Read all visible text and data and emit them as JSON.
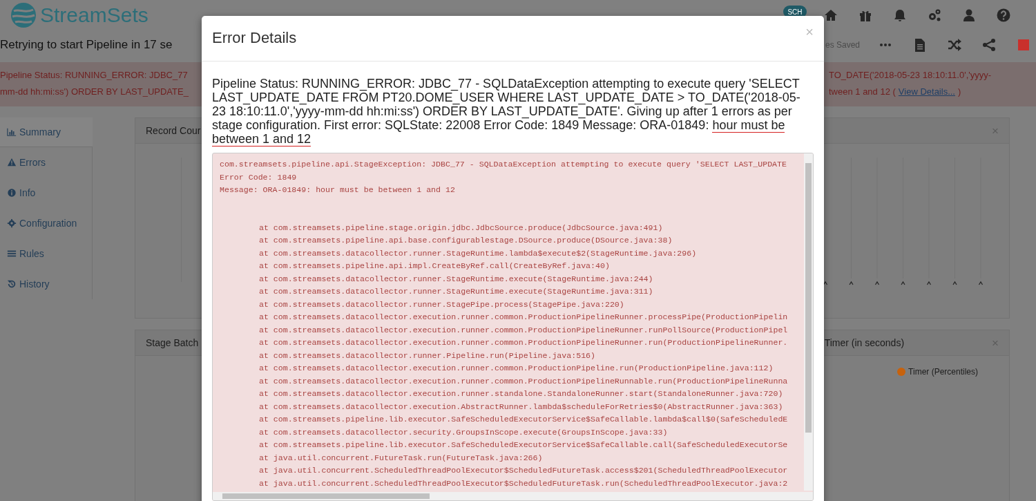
{
  "app": {
    "logo_text": "StreamSets",
    "header_icons": [
      {
        "kind": "cloud",
        "label": "SCH"
      },
      {
        "kind": "home"
      },
      {
        "kind": "gift"
      },
      {
        "kind": "bell"
      },
      {
        "kind": "gears"
      },
      {
        "kind": "user"
      },
      {
        "kind": "help"
      }
    ]
  },
  "status_title": "Retrying to start Pipeline in  17 se",
  "toolbar": {
    "saved_text": "es Saved",
    "buttons": [
      {
        "kind": "more"
      },
      {
        "kind": "document"
      },
      {
        "kind": "shuffle"
      },
      {
        "kind": "share"
      },
      {
        "kind": "stop"
      }
    ]
  },
  "alert": {
    "left_lines": [
      "Pipeline Status: RUNNING_ERROR: JDBC_77",
      "mm-dd hh:mi:ss') ORDER BY LAST_UPDATE_"
    ],
    "right_line": "TO_DATE('2018-05-23 18:10:11.0','yyyy-",
    "right_line_2": {
      "before": "tween 1 and 12 (",
      "link": "View Details...",
      "after": ")"
    }
  },
  "sidebar": {
    "items": [
      {
        "label": "Summary",
        "kind": "chart",
        "selected": true
      },
      {
        "label": "Errors",
        "kind": "warning",
        "selected": false
      },
      {
        "label": "Info",
        "kind": "info",
        "selected": false
      },
      {
        "label": "Configuration",
        "kind": "gear",
        "selected": false
      },
      {
        "label": "Rules",
        "kind": "list",
        "selected": false
      },
      {
        "label": "History",
        "kind": "history",
        "selected": false
      }
    ]
  },
  "panels": [
    {
      "kind": "gridlines",
      "title_left": "Record Cour",
      "close": "×"
    },
    {
      "kind": "legend",
      "title_left": "Stage Batch",
      "title_right": "Timer (in seconds)",
      "close": "×",
      "legend": "Timer (Percentiles)"
    }
  ],
  "modal": {
    "title": "Error Details",
    "close": "×",
    "message": [
      {
        "text": "Pipeline Status: RUNNING_ERROR: JDBC_77 - SQLDataException attempting to execute query 'SELECT LAST_UPDATE_DATE FROM PT20.DOME_USER WHERE LAST_UPDATE_DATE > TO_DATE('2018-05-23 18:10:11.0','yyyy-mm-dd hh:mi:ss') ORDER BY LAST_UPDATE_DATE'. Giving up after 1 errors as per stage configuration. First error: SQLState: 22008 Error Code: 1849 Message: ORA-01849: ",
        "marked": false
      },
      {
        "text": "hour must be between 1 and 12",
        "marked": true
      }
    ],
    "trace": [
      {
        "kind": "head",
        "text": "com.streamsets.pipeline.api.StageException: JDBC_77 - SQLDataException attempting to execute query 'SELECT LAST_UPDATE"
      },
      {
        "kind": "head",
        "text": "Error Code: 1849"
      },
      {
        "kind": "head",
        "text": "Message: ORA-01849: hour must be between 1 and 12"
      },
      {
        "kind": "frame",
        "text": "at com.streamsets.pipeline.stage.origin.jdbc.JdbcSource.produce(JdbcSource.java:491)"
      },
      {
        "kind": "frame",
        "text": "at com.streamsets.pipeline.api.base.configurablestage.DSource.produce(DSource.java:38)"
      },
      {
        "kind": "frame",
        "text": "at com.streamsets.datacollector.runner.StageRuntime.lambda$execute$2(StageRuntime.java:296)"
      },
      {
        "kind": "frame",
        "text": "at com.streamsets.pipeline.api.impl.CreateByRef.call(CreateByRef.java:40)"
      },
      {
        "kind": "frame",
        "text": "at com.streamsets.datacollector.runner.StageRuntime.execute(StageRuntime.java:244)"
      },
      {
        "kind": "frame",
        "text": "at com.streamsets.datacollector.runner.StageRuntime.execute(StageRuntime.java:311)"
      },
      {
        "kind": "frame",
        "text": "at com.streamsets.datacollector.runner.StagePipe.process(StagePipe.java:220)"
      },
      {
        "kind": "frame",
        "text": "at com.streamsets.datacollector.execution.runner.common.ProductionPipelineRunner.processPipe(ProductionPipelin"
      },
      {
        "kind": "frame",
        "text": "at com.streamsets.datacollector.execution.runner.common.ProductionPipelineRunner.runPollSource(ProductionPipel"
      },
      {
        "kind": "frame",
        "text": "at com.streamsets.datacollector.execution.runner.common.ProductionPipelineRunner.run(ProductionPipelineRunner."
      },
      {
        "kind": "frame",
        "text": "at com.streamsets.datacollector.runner.Pipeline.run(Pipeline.java:516)"
      },
      {
        "kind": "frame",
        "text": "at com.streamsets.datacollector.execution.runner.common.ProductionPipeline.run(ProductionPipeline.java:112)"
      },
      {
        "kind": "frame",
        "text": "at com.streamsets.datacollector.execution.runner.common.ProductionPipelineRunnable.run(ProductionPipelineRunna"
      },
      {
        "kind": "frame",
        "text": "at com.streamsets.datacollector.execution.runner.standalone.StandaloneRunner.start(StandaloneRunner.java:720)"
      },
      {
        "kind": "frame",
        "text": "at com.streamsets.datacollector.execution.AbstractRunner.lambda$scheduleForRetries$0(AbstractRunner.java:363)"
      },
      {
        "kind": "frame",
        "text": "at com.streamsets.pipeline.lib.executor.SafeScheduledExecutorService$SafeCallable.lambda$call$0(SafeScheduledE"
      },
      {
        "kind": "frame",
        "text": "at com.streamsets.datacollector.security.GroupsInScope.execute(GroupsInScope.java:33)"
      },
      {
        "kind": "frame",
        "text": "at com.streamsets.pipeline.lib.executor.SafeScheduledExecutorService$SafeCallable.call(SafeScheduledExecutorSe"
      },
      {
        "kind": "frame",
        "text": "at java.util.concurrent.FutureTask.run(FutureTask.java:266)"
      },
      {
        "kind": "frame",
        "text": "at java.util.concurrent.ScheduledThreadPoolExecutor$ScheduledFutureTask.access$201(ScheduledThreadPoolExecutor"
      },
      {
        "kind": "frame",
        "text": "at java.util.concurrent.ScheduledThreadPoolExecutor$ScheduledFutureTask.run(ScheduledThreadPoolExecutor.java:2"
      }
    ]
  }
}
